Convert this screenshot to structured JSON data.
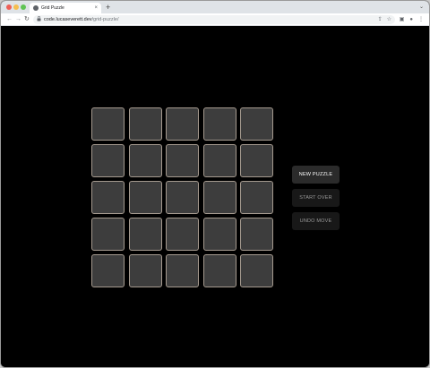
{
  "browser": {
    "tab_title": "Grid Puzzle",
    "tab_close": "×",
    "new_tab": "+",
    "tab_menu": "⌄",
    "back": "←",
    "forward": "→",
    "reload": "↻",
    "lock": "🔒",
    "url_domain": "code.lucaseverett.dev",
    "url_path": "/grid-puzzle/",
    "share_icon": "⇪",
    "bookmark_icon": "☆",
    "sidepanel_icon": "▣",
    "profile_icon": "●",
    "menu_icon": "⋮"
  },
  "puzzle": {
    "rows": 5,
    "cols": 5,
    "tile_fill": "#3d3d3d",
    "tile_border": "#a59a8f"
  },
  "controls": {
    "new_puzzle": "NEW PUZZLE",
    "start_over": "START OVER",
    "undo_move": "UNDO MOVE"
  }
}
